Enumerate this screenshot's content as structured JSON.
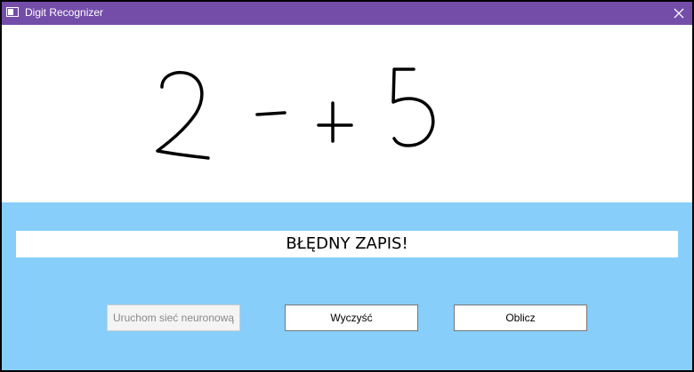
{
  "window": {
    "title": "Digit Recognizer",
    "close_glyph": "✕"
  },
  "canvas": {
    "drawn_symbols": [
      "2",
      "-",
      "+",
      "5"
    ]
  },
  "result": {
    "text": "BŁĘDNY ZAPIS!"
  },
  "buttons": {
    "run_label": "Uruchom sieć neuronową",
    "run_enabled": false,
    "clear_label": "Wyczyść",
    "compute_label": "Oblicz"
  },
  "colors": {
    "titlebar": "#744da9",
    "background": "#87cefa",
    "canvas": "#ffffff"
  }
}
